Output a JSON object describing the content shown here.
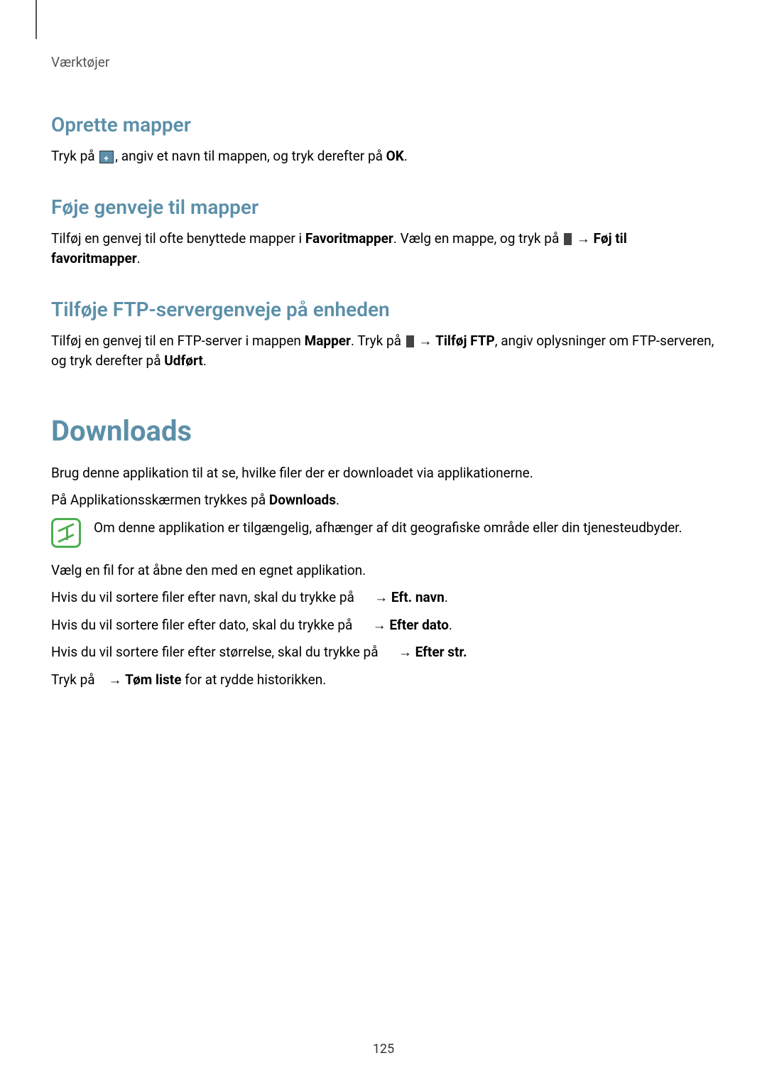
{
  "breadcrumb": "Værktøjer",
  "section1": {
    "title": "Oprette mapper",
    "text_before": "Tryk på ",
    "text_after": ", angiv et navn til mappen, og tryk derefter på ",
    "ok": "OK",
    "period": "."
  },
  "section2": {
    "title": "Føje genveje til mapper",
    "text1": "Tilføj en genvej til ofte benyttede mapper i ",
    "favoritmapper": "Favoritmapper",
    "text2": ". Vælg en mappe, og tryk på ",
    "arrow": " → ",
    "foj": "Føj til favoritmapper",
    "period": "."
  },
  "section3": {
    "title": "Tilføje FTP-servergenveje på enheden",
    "text1": "Tilføj en genvej til en FTP-server i mappen ",
    "mapper": "Mapper",
    "text2": ". Tryk på ",
    "arrow": " → ",
    "tilfoj_ftp": "Tilføj FTP",
    "text3": ", angiv oplysninger om FTP-serveren, og tryk derefter på ",
    "udfort": "Udført",
    "period": "."
  },
  "downloads": {
    "title": "Downloads",
    "p1": "Brug denne applikation til at se, hvilke filer der er downloadet via applikationerne.",
    "p2_before": "På Applikationsskærmen trykkes på ",
    "p2_bold": "Downloads",
    "p2_after": ".",
    "note": "Om denne applikation er tilgængelig, afhænger af dit geografiske område eller din tjenesteudbyder.",
    "p3": "Vælg en fil for at åbne den med en egnet applikation.",
    "sort1_before": "Hvis du vil sortere filer efter navn, skal du trykke på ",
    "sort1_arrow": " → ",
    "sort1_bold": "Eft. navn",
    "sort1_after": ".",
    "sort2_before": "Hvis du vil sortere filer efter dato, skal du trykke på ",
    "sort2_arrow": " → ",
    "sort2_bold": "Efter dato",
    "sort2_after": ".",
    "sort3_before": "Hvis du vil sortere filer efter størrelse, skal du trykke på ",
    "sort3_arrow": " → ",
    "sort3_bold": "Efter str.",
    "clear_before": "Tryk på ",
    "clear_arrow": " → ",
    "clear_bold": "Tøm liste",
    "clear_after": " for at rydde historikken."
  },
  "page_number": "125"
}
